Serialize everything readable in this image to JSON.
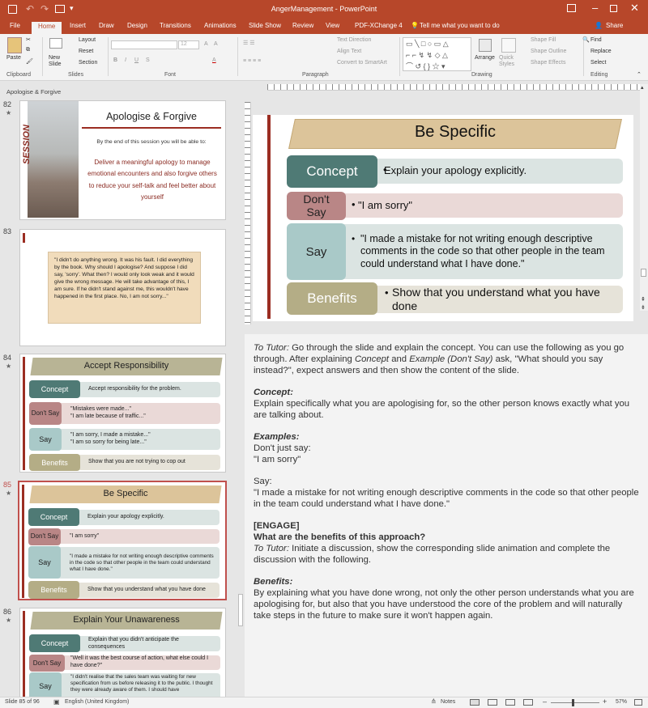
{
  "titlebar": {
    "title": "AngerManagement  -  PowerPoint",
    "share": "Share",
    "tell_me": "Tell me what you want to do"
  },
  "tabs": [
    "File",
    "Home",
    "Insert",
    "Draw",
    "Design",
    "Transitions",
    "Animations",
    "Slide Show",
    "Review",
    "View",
    "PDF-XChange 4"
  ],
  "ribbon": {
    "clipboard": {
      "label": "Clipboard",
      "paste": "Paste"
    },
    "slides": {
      "label": "Slides",
      "new_slide": "New Slide",
      "layout": "Layout",
      "reset": "Reset",
      "section": "Section"
    },
    "font": {
      "label": "Font",
      "size": "12"
    },
    "paragraph": {
      "label": "Paragraph",
      "text_direction": "Text Direction",
      "align_text": "Align Text",
      "convert": "Convert to SmartArt"
    },
    "drawing": {
      "label": "Drawing",
      "arrange": "Arrange",
      "quick_styles": "Quick Styles",
      "shape_fill": "Shape Fill",
      "shape_outline": "Shape Outline",
      "shape_effects": "Shape Effects"
    },
    "editing": {
      "label": "Editing",
      "find": "Find",
      "replace": "Replace",
      "select": "Select"
    }
  },
  "section_name": "Apologise & Forgive",
  "thumbs": {
    "s82": {
      "num": "82",
      "title": "Apologise & Forgive",
      "session": "SESSION",
      "intro": "By the end of this session you will be able to:",
      "body": "Deliver a meaningful apology to manage emotional encounters and also forgive others to reduce your self-talk and feel better about yourself"
    },
    "s83": {
      "num": "83",
      "quote": "\"I didn't do anything wrong. It was his fault. I did everything by the book. Why should I apologise? And suppose I did say, 'sorry'. What then? I would only look weak and it would give the wrong message. He will take advantage of this, I am sure. If he didn't stand against me, this wouldn't have happened in the first place. No, I am not sorry...\""
    },
    "s84": {
      "num": "84",
      "title": "Accept Responsibility",
      "concept_label": "Concept",
      "concept_text": "Accept responsibility for the problem.",
      "dont_label": "Don't Say",
      "dont_1": "\"Mistakes were made...\"",
      "dont_2": "\"I am late because of traffic...\"",
      "say_label": "Say",
      "say_1": "\"I am sorry, I made a mistake...\"",
      "say_2": "\"I am so sorry for being late...\"",
      "ben_label": "Benefits",
      "ben_text": "Show that you are not trying to cop out"
    },
    "s85": {
      "num": "85",
      "title": "Be Specific",
      "concept_label": "Concept",
      "concept_text": "Explain your apology explicitly.",
      "dont_label": "Don't Say",
      "dont_text": "\"I am sorry\"",
      "say_label": "Say",
      "say_text": "\"I made a mistake for not writing enough descriptive comments in the code so that other people in the team could understand what I have done.\"",
      "ben_label": "Benefits",
      "ben_text": "Show that you understand what you have done"
    },
    "s86": {
      "num": "86",
      "title": "Explain Your Unawareness",
      "concept_label": "Concept",
      "concept_text": "Explain that you didn't anticipate the consequences",
      "dont_label": "Don't Say",
      "dont_text": "\"Well it was the best course of action, what else could I have done?\"",
      "say_label": "Say",
      "say_text": "\"I didn't realise that the sales team was waiting for new specification from us before releasing it to the public. I thought they were already aware of them. I should have"
    }
  },
  "main_slide": {
    "title": "Be Specific",
    "concept_label": "Concept",
    "concept_text": "Explain your apology explicitly.",
    "dont_label_1": "Don't",
    "dont_label_2": "Say",
    "dont_text": "\"I am sorry\"",
    "say_label": "Say",
    "say_text": "\"I made a mistake for not writing enough descriptive comments in the code so that other people in the team could understand what I have done.\"",
    "ben_label": "Benefits",
    "ben_text": "Show that you understand what you have done"
  },
  "notes": {
    "p1_label": "To Tutor:",
    "p1_a": " Go through the slide and explain the concept. You can use the following as you go through. After explaining ",
    "p1_concept": "Concept",
    "p1_and": " and ",
    "p1_example": "Example (Don't Say)",
    "p1_b": " ask, \"What should you say instead?\", expect answers and then show the content of the slide.",
    "concept_head": "Concept:",
    "concept_body": "Explain specifically what you are apologising for, so the other person knows exactly what you are talking about.",
    "examples_head": "Examples:",
    "ex_dont": "Don't just say:",
    "ex_dont_q": "\"I am sorry\"",
    "ex_say": "Say:",
    "ex_say_q": "\"I made a mistake for not writing enough descriptive comments in the code so that other people in the team could understand what I have done.\"",
    "engage": "[ENGAGE]",
    "benefits_q": "What are the benefits of this approach?",
    "tutor2_label": "To Tutor:",
    "tutor2_body": " Initiate a discussion, show the corresponding slide animation and complete the discussion with the following.",
    "benefits_head": "Benefits:",
    "benefits_body": "By explaining what you have done wrong, not only the other person understands what you are apologising for, but also that you have understood the core of the problem and will naturally take steps in the future to make sure it won't happen again."
  },
  "status": {
    "slide": "Slide 85 of 96",
    "language": "English (United Kingdom)",
    "notes": "Notes",
    "zoom": "57%"
  }
}
